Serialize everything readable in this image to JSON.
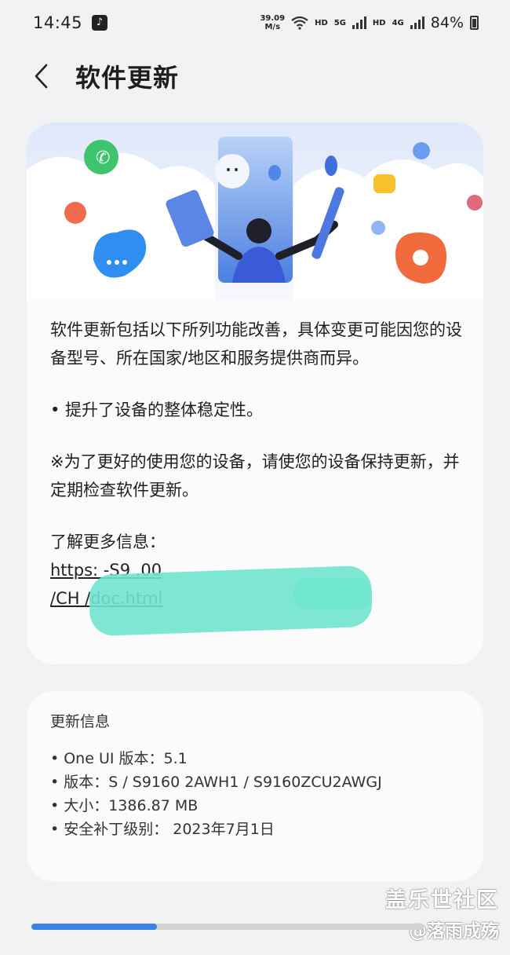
{
  "status_bar": {
    "time": "14:45",
    "net_speed_value": "39.09",
    "net_speed_unit": "M/s",
    "wifi_badge": "6",
    "hd1": "HD",
    "sig1": "5G",
    "hd2": "HD",
    "sig2": "4G",
    "battery": "84%"
  },
  "header": {
    "title": "软件更新"
  },
  "main": {
    "intro": "软件更新包括以下所列功能改善，具体变更可能因您的设备型号、所在国家/地区和服务提供商而异。",
    "bullet": "• 提升了设备的整体稳定性。",
    "note": "※为了更好的使用您的设备，请使您的设备保持更新，并定期检查软件更新。",
    "link_label": "了解更多信息：",
    "link_line1": "https:                                         -S9  .00",
    "link_line2": "/CH /doc.html"
  },
  "update_info": {
    "title": "更新信息",
    "items": [
      "One UI 版本：5.1",
      "版本：S                        / S9160        2AWH1 / S9160ZCU2AWGJ",
      "大小：1386.87 MB",
      "安全补丁级别： 2023年7月1日"
    ]
  },
  "progress": {
    "fraction": 0.32
  },
  "watermark": {
    "line1": "盖乐世社区",
    "line2": "@落雨成殇"
  },
  "colors": {
    "accent": "#3b82e4",
    "background": "#f2f2f4",
    "card": "#fbfbfc"
  }
}
